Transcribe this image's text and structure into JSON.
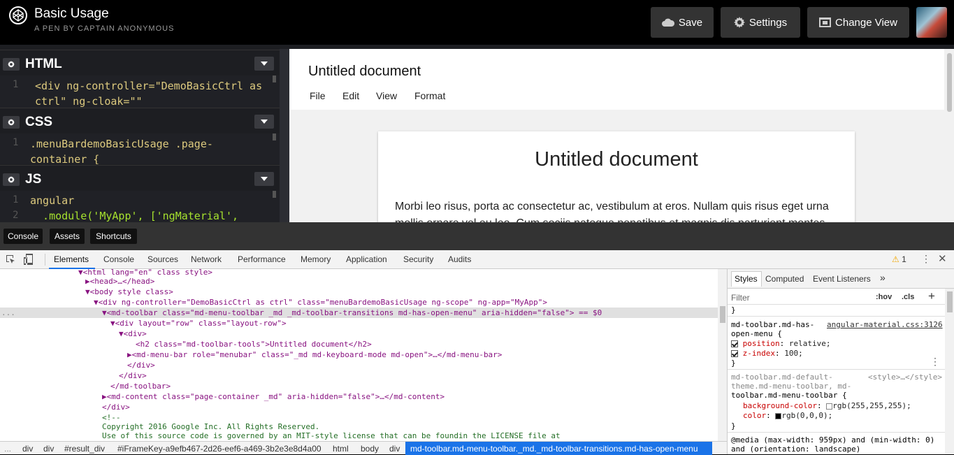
{
  "header": {
    "title": "Basic Usage",
    "subtitle": "A PEN BY CAPTAIN ANONYMOUS",
    "save_label": "Save",
    "settings_label": "Settings",
    "change_view_label": "Change View"
  },
  "editors": {
    "html": {
      "label": "HTML",
      "line": "1",
      "code_1": "<div ng-controller=\"DemoBasicCtrl as",
      "code_2": "ctrl\" ng-cloak=\"\""
    },
    "css": {
      "label": "CSS",
      "line": "1",
      "code_1": ".menuBardemoBasicUsage .page-",
      "code_2": "container {"
    },
    "js": {
      "label": "JS",
      "line_1": "1",
      "line_2": "2",
      "code_1": "angular",
      "code_2": "  .module('MyApp', ['ngMaterial',"
    }
  },
  "preview": {
    "toolbar_title": "Untitled document",
    "menus": [
      "File",
      "Edit",
      "View",
      "Format"
    ],
    "doc_title": "Untitled document",
    "doc_body": "Morbi leo risus, porta ac consectetur ac, vestibulum at eros. Nullam quis risus eget urna mollis ornare vel eu leo. Cum sociis natoque penatibus et magnis dis parturient montes"
  },
  "console_bar": {
    "console": "Console",
    "assets": "Assets",
    "shortcuts": "Shortcuts"
  },
  "devtools": {
    "tabs": [
      "Elements",
      "Console",
      "Sources",
      "Network",
      "Performance",
      "Memory",
      "Application",
      "Security",
      "Audits"
    ],
    "warning_count": "1",
    "tree": [
      "<html lang=\"en\" class style>",
      "<head>…</head>",
      "<body style class>",
      "<div ng-controller=\"DemoBasicCtrl as ctrl\" class=\"menuBardemoBasicUsage ng-scope\" ng-app=\"MyApp\">",
      "<md-toolbar class=\"md-menu-toolbar _md _md-toolbar-transitions md-has-open-menu\" aria-hidden=\"false\"> == $0",
      "<div layout=\"row\" class=\"layout-row\">",
      "<div>",
      "<h2 class=\"md-toolbar-tools\">Untitled document</h2>",
      "<md-menu-bar role=\"menubar\" class=\"_md md-keyboard-mode md-open\">…</md-menu-bar>",
      "</div>",
      "</div>",
      "</md-toolbar>",
      "<md-content class=\"page-container _md\" aria-hidden=\"false\">…</md-content>",
      "</div>",
      "<!--",
      "Copyright 2016 Google Inc. All Rights Reserved.",
      "Use of this source code is governed by an MIT-style license that can be foundin the LICENSE file at"
    ],
    "breadcrumbs": [
      "div",
      "div",
      "#result_div",
      "#iFrameKey-a9efb467-2d26-eef6-a469-3b2e3e8d4a00",
      "html",
      "body",
      "div"
    ],
    "breadcrumb_selected": "md-toolbar.md-menu-toolbar._md._md-toolbar-transitions.md-has-open-menu",
    "styles": {
      "tabs": [
        "Styles",
        "Computed",
        "Event Listeners"
      ],
      "more": "»",
      "filter_placeholder": "Filter",
      "hov": ":hov",
      "cls": ".cls",
      "close_brace": "}",
      "rule1_selector_1": "md-toolbar.md-has-",
      "rule1_selector_2": "open-menu {",
      "rule1_source": "angular-material.css:3126",
      "rule1_prop1": "position",
      "rule1_val1": "relative;",
      "rule1_prop2": "z-index",
      "rule1_val2": "100;",
      "rule2_selector_1": "md-toolbar.md-default-",
      "rule2_selector_2": "theme.md-menu-toolbar, md-",
      "rule2_selector_3": "toolbar.md-menu-toolbar {",
      "rule2_source": "<style>…</style>",
      "rule2_prop1": "background-color",
      "rule2_val1": "rgb(255,255,255);",
      "rule2_prop2": "color",
      "rule2_val2": "rgb(0,0,0);",
      "media_1": "@media (max-width: 959px) and (min-width: 0)",
      "media_2": "and (orientation: landscape)"
    }
  }
}
